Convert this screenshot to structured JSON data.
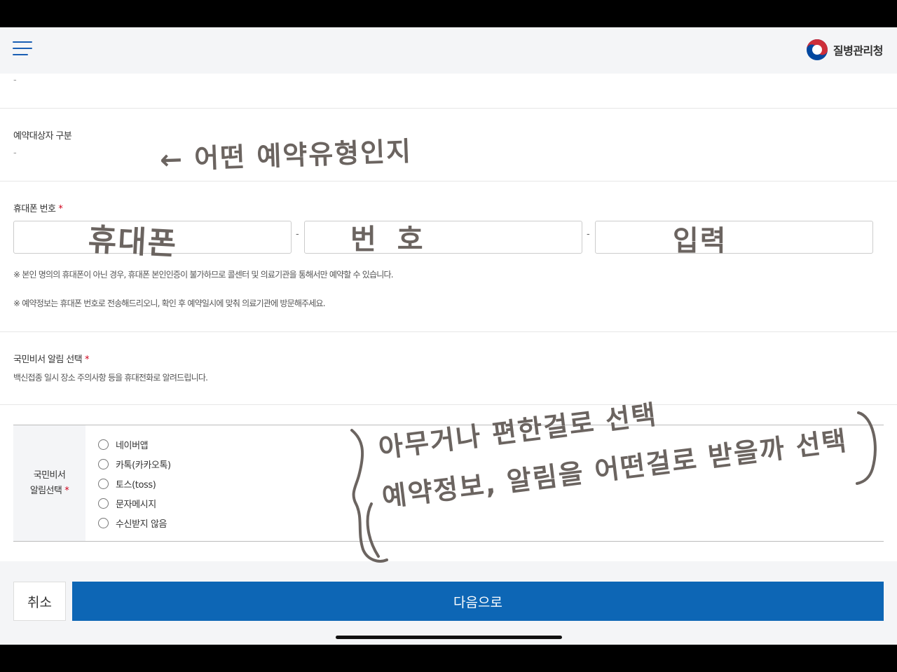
{
  "header": {
    "org_name": "질병관리청",
    "logo_colors": {
      "red": "#cd2e3a",
      "blue": "#0047a0"
    }
  },
  "top_value": "-",
  "reservation_type": {
    "label": "예약대상자 구분",
    "value": "-"
  },
  "phone": {
    "label": "휴대폰 번호",
    "required_mark": "*",
    "separator": "-",
    "notes": [
      "※ 본인 명의의 휴대폰이 아닌 경우, 휴대폰 본인인증이 불가하므로 콜센터 및 의료기관을 통해서만 예약할 수 있습니다.",
      "※ 예약정보는 휴대폰 번호로 전송해드리오니, 확인 후 예약일시에 맞춰 의료기관에 방문해주세요."
    ]
  },
  "notification": {
    "section_title": "국민비서 알림 선택",
    "required_mark": "*",
    "description": "백신접종 일시 장소 주의사항 등을 휴대전화로 알려드립니다.",
    "table_header_line1": "국민비서",
    "table_header_line2": "알림선택",
    "options": [
      "네이버앱",
      "카톡(카카오톡)",
      "토스(toss)",
      "문자메시지",
      "수신받지 않음"
    ]
  },
  "buttons": {
    "cancel": "취소",
    "next": "다음으로",
    "next_color": "#0d66b5"
  },
  "annotations": {
    "arrow_note": "← 어떤 예약유형인지",
    "phone_note_1": "휴대폰",
    "phone_note_2": "번호",
    "phone_note_3": "입력",
    "notify_note_1": "아무거나 편한걸로 선택",
    "notify_note_2": "예약정보, 알림을 어떤걸로 받을까 선택"
  }
}
